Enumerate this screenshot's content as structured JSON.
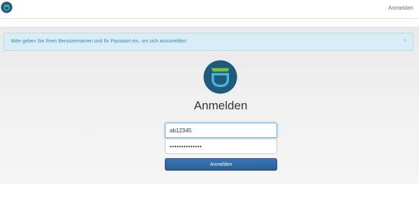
{
  "navbar": {
    "logo": "privacyidea-logo-icon",
    "login_link": "Anmelden"
  },
  "alert": {
    "message": "Bitte geben Sie Ihren Benutzernamen und Ihr Passwort ein, um sich anzumelden.",
    "close_symbol": "×"
  },
  "login": {
    "logo": "privacyidea-logo-icon",
    "title": "Anmelden",
    "username_value": "ab12345",
    "password_value": "••••••••••••••",
    "submit_label": "Anmelden"
  },
  "colors": {
    "logo_dark": "#1e5b7b",
    "logo_accent": "#7cc142",
    "logo_light": "#4db4dd",
    "button": "#30679f",
    "alert_bg": "#d9edf7",
    "alert_text": "#3a87ad"
  }
}
